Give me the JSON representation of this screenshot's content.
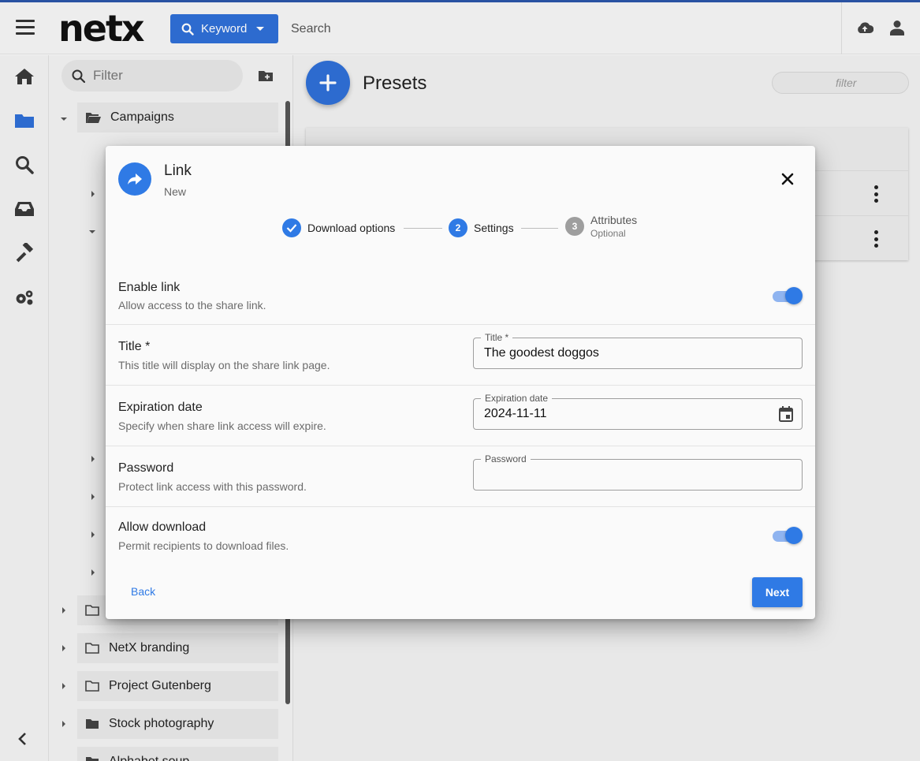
{
  "app": {
    "logo": "netx",
    "search": {
      "mode_label": "Keyword",
      "placeholder": "Search"
    }
  },
  "tree": {
    "filter_placeholder": "Filter",
    "top_item": "Campaigns",
    "folders": [
      "NetX branding",
      "Project Gutenberg",
      "Stock photography",
      "Alphabet soup"
    ]
  },
  "main": {
    "title": "Presets",
    "filter_placeholder": "filter"
  },
  "dialog": {
    "title": "Link",
    "subtitle": "New",
    "steps": [
      {
        "number": "",
        "label": "Download options",
        "sublabel": "",
        "state": "complete"
      },
      {
        "number": "2",
        "label": "Settings",
        "sublabel": "",
        "state": "active"
      },
      {
        "number": "3",
        "label": "Attributes",
        "sublabel": "Optional",
        "state": "pending"
      }
    ],
    "rows": [
      {
        "label": "Enable link",
        "description": "Allow access to the share link.",
        "control": "toggle",
        "enabled": true
      },
      {
        "label": "Title *",
        "description": "This title will display on the share link page.",
        "control": "field",
        "field_label": "Title *",
        "value": "The goodest doggos"
      },
      {
        "label": "Expiration date",
        "description": "Specify when share link access will expire.",
        "control": "date",
        "field_label": "Expiration date",
        "value": "2024-11-11"
      },
      {
        "label": "Password",
        "description": "Protect link access with this password.",
        "control": "field",
        "field_label": "Password",
        "value": ""
      },
      {
        "label": "Allow download",
        "description": "Permit recipients to download files.",
        "control": "toggle",
        "enabled": true
      }
    ],
    "back_label": "Back",
    "next_label": "Next"
  },
  "colors": {
    "accent": "#2f7ae5",
    "brand_button": "#2f6fd6",
    "top_line": "#2b55a8"
  },
  "icons": [
    "hamburger-icon",
    "search-icon",
    "cloud-upload-icon",
    "user-icon",
    "home-icon",
    "folder-icon",
    "inbox-icon",
    "hammer-icon",
    "gears-icon",
    "chevron-left-icon",
    "add-folder-icon",
    "plus-icon",
    "share-icon",
    "close-icon",
    "check-icon",
    "calendar-icon",
    "more-vert-icon"
  ]
}
